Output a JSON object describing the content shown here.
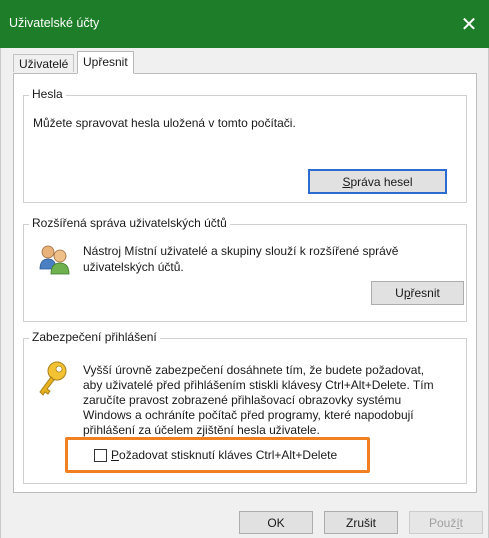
{
  "window": {
    "title": "Uživatelské účty",
    "close_glyph": "✕"
  },
  "tabs": [
    {
      "label": "Uživatelé"
    },
    {
      "label": "Upřesnit"
    }
  ],
  "passwords": {
    "title": "Hesla",
    "description": "Můžete spravovat hesla uložená v tomto počítači.",
    "button": {
      "mnemonic": "S",
      "rest": "práva hesel"
    }
  },
  "advanced_mgmt": {
    "title": "Rozšířená správa uživatelských účtů",
    "description_line1": "Nástroj Místní uživatelé a skupiny slouží k rozšířené správě",
    "description_line2": "uživatelských účtů.",
    "button": {
      "prefix": "U",
      "mnemonic": "p",
      "rest": "řesnit"
    },
    "icon": "users-icon"
  },
  "secure_logon": {
    "title": "Zabezpečení přihlášení",
    "lines": [
      "Vyšší úrovně zabezpečení dosáhnete tím, že budete požadovat,",
      "aby uživatelé před přihlášením stiskli klávesy Ctrl+Alt+Delete. Tím",
      "zaručíte pravost zobrazené přihlašovací obrazovky systému",
      "Windows a ochráníte počítač před programy, které napodobují",
      "přihlášení za účelem zjištění hesla uživatele."
    ],
    "checkbox": {
      "mnemonic": "P",
      "rest": "ožadovat stisknutí kláves Ctrl+Alt+Delete",
      "checked": false
    },
    "icon": "key-icon"
  },
  "footer": {
    "ok": "OK",
    "cancel": "Zrušit",
    "apply": {
      "prefix": "Použ",
      "mnemonic": "í",
      "rest": "t"
    }
  },
  "colors": {
    "titlebar": "#1e7d28",
    "highlight": "#f08022",
    "default_button_border": "#2c6bd0"
  }
}
